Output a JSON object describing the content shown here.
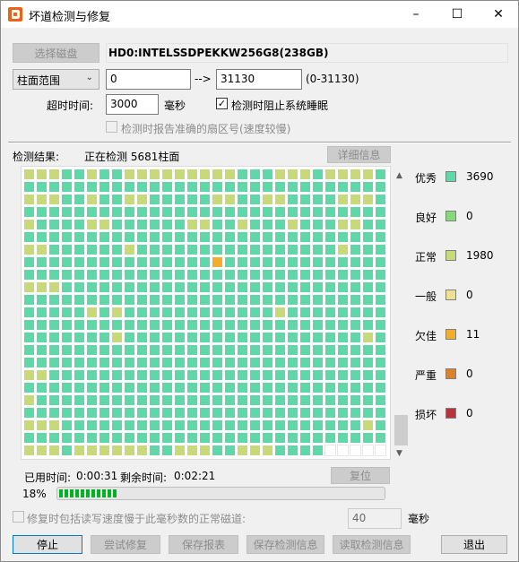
{
  "window": {
    "title": "坏道检测与修复",
    "minimize_label": "–",
    "maximize_label": "☐",
    "close_label": "✕"
  },
  "disk": {
    "select_button": "选择磁盘",
    "name": "HD0:INTELSSDPEKKW256G8(238GB)"
  },
  "range": {
    "mode": "柱面范围",
    "start": "0",
    "arrow": "-->",
    "end": "31130",
    "limit": "(0-31130)"
  },
  "timeout": {
    "label": "超时时间:",
    "value": "3000",
    "unit": "毫秒"
  },
  "options": {
    "prevent_sleep": "检测时阻止系统睡眠",
    "prevent_sleep_checked": "✓",
    "report_sector": "检测时报告准确的扇区号(速度较慢)"
  },
  "results": {
    "label": "检测结果:",
    "status": "正在检测 5681柱面",
    "detail_button": "详细信息"
  },
  "legend": [
    {
      "label": "优秀",
      "count": "3690",
      "color": "#5fd7a8"
    },
    {
      "label": "良好",
      "count": "0",
      "color": "#86d97a"
    },
    {
      "label": "正常",
      "count": "1980",
      "color": "#c8d97a"
    },
    {
      "label": "一般",
      "count": "0",
      "color": "#ede08f"
    },
    {
      "label": "欠佳",
      "count": "11",
      "color": "#f2ad2c"
    },
    {
      "label": "严重",
      "count": "0",
      "color": "#d9822b"
    },
    {
      "label": "损坏",
      "count": "0",
      "color": "#b8343d"
    }
  ],
  "timing": {
    "elapsed_label": "已用时间:",
    "elapsed": "0:00:31",
    "remaining_label": "剩余时间:",
    "remaining": "0:02:21",
    "reset_button": "复位"
  },
  "progress": {
    "percent_text": "18%",
    "fraction": 0.18
  },
  "repair": {
    "label": "修复时包括读写速度慢于此毫秒数的正常磁道:",
    "value": "40",
    "unit": "毫秒"
  },
  "buttons": {
    "stop": "停止",
    "try_repair": "尝试修复",
    "save_report": "保存报表",
    "save_info": "保存检测信息",
    "read_info": "读取检测信息",
    "exit": "退出"
  },
  "grid": {
    "columns": 29,
    "rows": 23,
    "filled": 662,
    "empty_color": "#ffffff",
    "rows_pattern": [
      "yyyggyggyyyyyyyyygggyyygyyyyg",
      "ggggggggggggggggggggggggggggg",
      "yyyggyggyygggggyyggyyggggyyyg",
      "ggggggggggggggggggggggggggggg",
      "yggggyyggggggyyggygggygggyygg",
      "ggggggggggggggggggggggggggggg",
      "yyggggggyggggggggggggggggyggg",
      "gggggggggggggggoggggggggggggg",
      "ggggggggggggggggggggggggggggg",
      "yyygggggggggggggggggggggggggg",
      "ggggggggggggggggggggggggggggg",
      "gggggygyggggggggggggygggggggg",
      "ggggggggggggggggggggggggggggg",
      "gggggggygggggggggggggggggggyg",
      "ggggggggggggggggggggggggggggg",
      "ggggggggggggggggggggggggggggg",
      "yyggggggggggggggggggggggggggg",
      "ggggggggggggggggggggggggggggg",
      "ygggggggggggggggggggggggggggg",
      "ggggggggggggggggggggggggggggg",
      "yyyggggggggggggggggggggggggyg",
      "ggggggggggggggggggggggggggggg",
      "yyygyyyyyyggyyyggyyygggg....."
    ]
  }
}
